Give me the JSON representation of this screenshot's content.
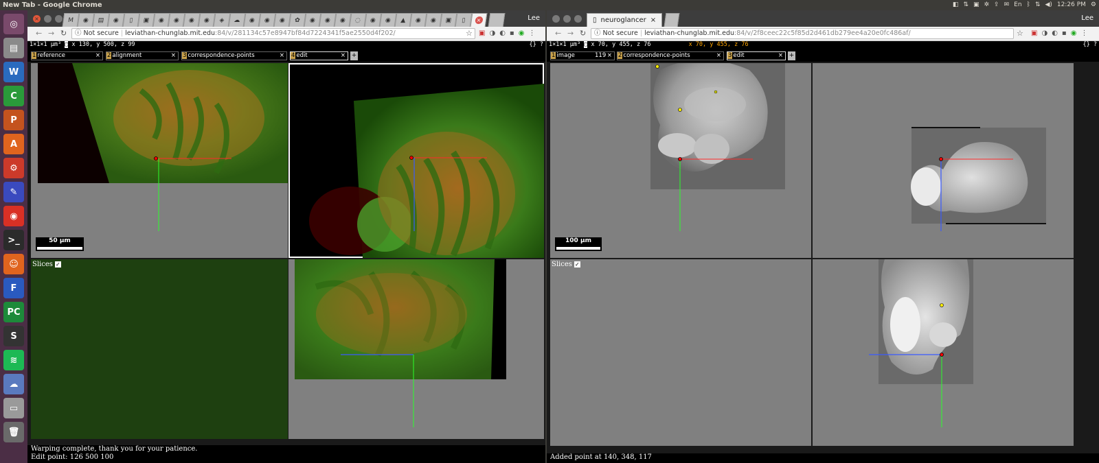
{
  "os": {
    "window_title": "New Tab - Google Chrome",
    "time": "12:26 PM",
    "tray": [
      "En"
    ],
    "launcher": [
      {
        "icon": "ubuntu-dash-icon",
        "color": "#7a4a6b",
        "glyph": "◎"
      },
      {
        "icon": "files-icon",
        "color": "#8a8a8a",
        "glyph": "▤"
      },
      {
        "icon": "writer-icon",
        "color": "#2a6bbf",
        "glyph": "W"
      },
      {
        "icon": "calc-icon",
        "color": "#2a9a3a",
        "glyph": "C"
      },
      {
        "icon": "impress-icon",
        "color": "#c4531e",
        "glyph": "P"
      },
      {
        "icon": "software-center-icon",
        "color": "#e0641e",
        "glyph": "A"
      },
      {
        "icon": "settings-icon",
        "color": "#cc3a2a",
        "glyph": "⚙"
      },
      {
        "icon": "editor-icon",
        "color": "#3a4abf",
        "glyph": "✎"
      },
      {
        "icon": "chrome-icon",
        "color": "#d93025",
        "glyph": "◉"
      },
      {
        "icon": "terminal-icon",
        "color": "#2b2b2b",
        "glyph": ">_"
      },
      {
        "icon": "mascot-icon",
        "color": "#e0641e",
        "glyph": "☺"
      },
      {
        "icon": "fiji-icon",
        "color": "#2a5abf",
        "glyph": "F"
      },
      {
        "icon": "pycharm-icon",
        "color": "#1d8a3a",
        "glyph": "PC"
      },
      {
        "icon": "sublime-icon",
        "color": "#333333",
        "glyph": "S"
      },
      {
        "icon": "spotify-icon",
        "color": "#1db954",
        "glyph": "≋"
      },
      {
        "icon": "network-icon",
        "color": "#5a7abf",
        "glyph": "☁"
      },
      {
        "icon": "disk-icon",
        "color": "#9a9a9a",
        "glyph": "▭"
      },
      {
        "icon": "trash-icon",
        "color": "#6a6a6a",
        "glyph": "🗑"
      }
    ]
  },
  "left": {
    "profile": "Lee",
    "url_host": "leviathan-chunglab.mit.edu",
    "url_rest": ":84/v/281134c57e8947bf84d7224341f5ae2550d4f202/",
    "not_secure": "Not secure",
    "voxel": "1×1×1 µm³",
    "coords": "x 130,  y 500,  z 99",
    "coords_extra": "",
    "right_icons": "{} ?",
    "layers": [
      {
        "num": "1",
        "name": "reference",
        "extra": ""
      },
      {
        "num": "2",
        "name": "alignment",
        "extra": ""
      },
      {
        "num": "3",
        "name": "correspondence-points",
        "extra": ""
      },
      {
        "num": "4",
        "name": "edit",
        "extra": ""
      }
    ],
    "scalebar": "50 µm",
    "slices_label": "Slices",
    "status_line1": "Warping complete, thank you for your patience.",
    "status_line2": "Edit point: 126 500 100"
  },
  "right": {
    "tab_title": "neuroglancer",
    "profile": "Lee",
    "url_host": "leviathan-chunglab.mit.edu",
    "url_rest": ":84/v/2f8ceec22c5f85d2d461db279ee4a20e0fc486af/",
    "not_secure": "Not secure",
    "voxel": "1×1×1 µm³",
    "coords": "x 70,  y 455,  z 76",
    "coords_extra": "x 70,  y 455,  z 76",
    "right_icons": "{} ?",
    "layers": [
      {
        "num": "1",
        "name": "image",
        "extra": "119"
      },
      {
        "num": "2",
        "name": "correspondence-points",
        "extra": ""
      },
      {
        "num": "3",
        "name": "edit",
        "extra": ""
      }
    ],
    "scalebar": "100 µm",
    "slices_label": "Slices",
    "status_line1": "Added point at 140, 348, 117"
  },
  "colors": {
    "panel_gray": "#808080",
    "tissue_green": "#2f6a12",
    "tissue_orange": "#c0641e",
    "cursor_red": "#ff2a2a",
    "axis_green": "#2aff2a",
    "axis_blue": "#3a5aff",
    "annotation_yellow": "#ffee00",
    "accent_layer": "#c9a14a"
  }
}
